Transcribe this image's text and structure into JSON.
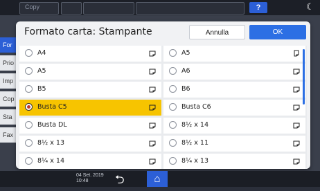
{
  "topbar": {
    "title": "Copy"
  },
  "background_tabs": [
    "For",
    "Prio",
    "Imp",
    "Cop",
    "Sta",
    "Fax"
  ],
  "dialog": {
    "title": "Formato carta: Stampante",
    "cancel_label": "Annulla",
    "ok_label": "OK"
  },
  "paper_sizes": [
    {
      "label": "A4",
      "orientation": "landscape-icon",
      "selected": false
    },
    {
      "label": "A5",
      "orientation": "portrait-icon",
      "selected": false
    },
    {
      "label": "A5",
      "orientation": "landscape-icon",
      "selected": false
    },
    {
      "label": "A6",
      "orientation": "landscape-icon",
      "selected": false
    },
    {
      "label": "B5",
      "orientation": "landscape-icon",
      "selected": false
    },
    {
      "label": "B6",
      "orientation": "landscape-icon",
      "selected": false
    },
    {
      "label": "Busta C5",
      "orientation": "landscape-icon",
      "selected": true
    },
    {
      "label": "Busta C6",
      "orientation": "landscape-icon",
      "selected": false
    },
    {
      "label": "Busta DL",
      "orientation": "landscape-icon",
      "selected": false
    },
    {
      "label": "8½ x 14",
      "orientation": "landscape-icon",
      "selected": false
    },
    {
      "label": "8½ x 13",
      "orientation": "landscape-icon",
      "selected": false
    },
    {
      "label": "8½ x 11",
      "orientation": "landscape-icon",
      "selected": false
    },
    {
      "label": "8¼ x 14",
      "orientation": "landscape-icon",
      "selected": false
    },
    {
      "label": "8¼ x 13",
      "orientation": "landscape-icon",
      "selected": false
    }
  ],
  "status": {
    "date": "04 Set. 2019",
    "time": "10:48"
  },
  "colors": {
    "accent": "#2c6fe4",
    "selected": "#f7c400"
  }
}
